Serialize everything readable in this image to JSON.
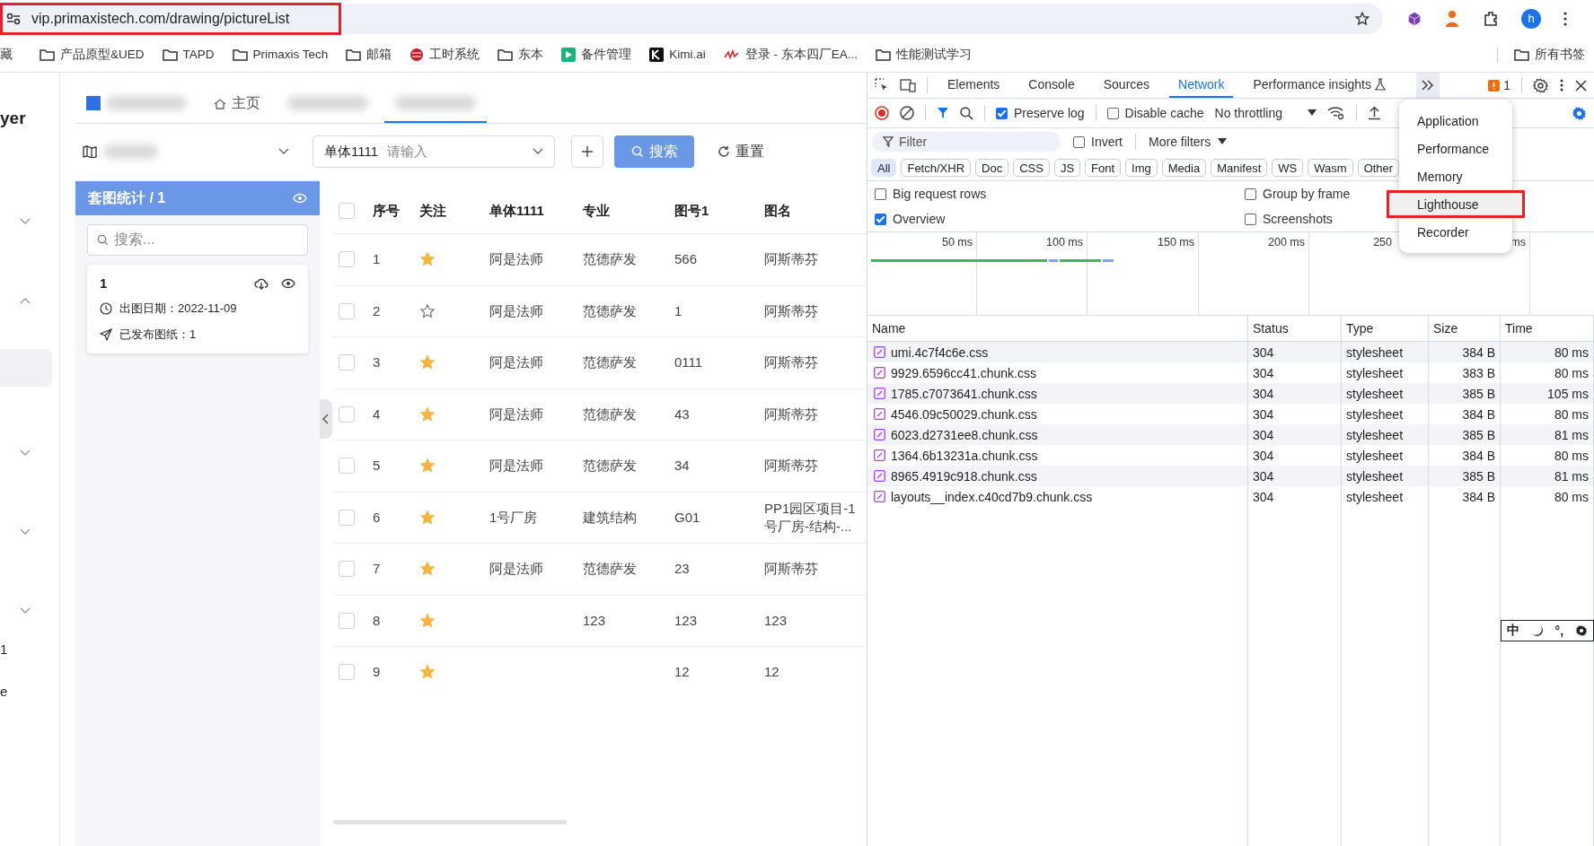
{
  "browser": {
    "address": "vip.primaxistech.com/drawing/pictureList",
    "address_annotated": true,
    "profile_initial": "h"
  },
  "bookmarks": [
    {
      "label": "藏",
      "kind": "none"
    },
    {
      "label": "产品原型&UED",
      "kind": "folder"
    },
    {
      "label": "TAPD",
      "kind": "folder"
    },
    {
      "label": "Primaxis Tech",
      "kind": "folder"
    },
    {
      "label": "邮箱",
      "kind": "folder"
    },
    {
      "label": "工时系统",
      "kind": "globe"
    },
    {
      "label": "东本",
      "kind": "folder"
    },
    {
      "label": "备件管理",
      "kind": "play"
    },
    {
      "label": "Kimi.ai",
      "kind": "letter"
    },
    {
      "label": "登录 - 东本四厂EA...",
      "kind": "mark"
    },
    {
      "label": "性能测试学习",
      "kind": "folder"
    }
  ],
  "bookmarks_all": "所有书签",
  "app": {
    "side_nav": [
      {
        "kind": "text",
        "label": "yer"
      },
      {
        "kind": "chevron",
        "expanded": false
      },
      {
        "kind": "chevron",
        "expanded": true
      },
      {
        "kind": "blank",
        "selected": true
      },
      {
        "kind": "chevron",
        "expanded": false
      },
      {
        "kind": "chevron",
        "expanded": false
      },
      {
        "kind": "chevron",
        "expanded": false
      },
      {
        "kind": "text",
        "label": "1"
      },
      {
        "kind": "text",
        "label": "e"
      }
    ],
    "tabs": [
      {
        "kind": "blurred",
        "selected": false
      },
      {
        "kind": "home",
        "label": "主页",
        "selected": false
      },
      {
        "kind": "blurred",
        "selected": false
      },
      {
        "kind": "blurred",
        "selected": true
      }
    ],
    "filter": {
      "field_label": "单体1111",
      "placeholder": "请输入",
      "search_button": "搜索",
      "reset_button": "重置"
    },
    "panel": {
      "title": "套图统计 / 1",
      "search_placeholder": "搜索...",
      "card": {
        "title": "1",
        "date": "出图日期：2022-11-09",
        "published": "已发布图纸：1"
      }
    },
    "table": {
      "checked": false,
      "columns": [
        "序号",
        "关注",
        "单体1111",
        "专业",
        "图号1",
        "图名"
      ],
      "rows": [
        {
          "no": "1",
          "starred": true,
          "unit": "阿是法师",
          "discipline": "范德萨发",
          "drawing_no": "566",
          "drawing_name": "阿斯蒂芬",
          "checked": false
        },
        {
          "no": "2",
          "starred": false,
          "unit": "阿是法师",
          "discipline": "范德萨发",
          "drawing_no": "1",
          "drawing_name": "阿斯蒂芬",
          "checked": false
        },
        {
          "no": "3",
          "starred": true,
          "unit": "阿是法师",
          "discipline": "范德萨发",
          "drawing_no": "0111",
          "drawing_name": "阿斯蒂芬",
          "checked": false
        },
        {
          "no": "4",
          "starred": true,
          "unit": "阿是法师",
          "discipline": "范德萨发",
          "drawing_no": "43",
          "drawing_name": "阿斯蒂芬",
          "checked": false
        },
        {
          "no": "5",
          "starred": true,
          "unit": "阿是法师",
          "discipline": "范德萨发",
          "drawing_no": "34",
          "drawing_name": "阿斯蒂芬",
          "checked": false
        },
        {
          "no": "6",
          "starred": true,
          "unit": "1号厂房",
          "discipline": "建筑结构",
          "drawing_no": "G01",
          "drawing_name": "PP1园区项目-1号厂房-结构-...",
          "checked": false
        },
        {
          "no": "7",
          "starred": true,
          "unit": "阿是法师",
          "discipline": "范德萨发",
          "drawing_no": "23",
          "drawing_name": "阿斯蒂芬",
          "checked": false
        },
        {
          "no": "8",
          "starred": true,
          "discipline": "123",
          "drawing_no": "123",
          "drawing_name": "123",
          "checked": false
        },
        {
          "no": "9",
          "starred": true,
          "drawing_no": "12",
          "drawing_name": "12",
          "checked": false
        }
      ]
    }
  },
  "devtools": {
    "tabs": [
      {
        "label": "Elements",
        "selected": false
      },
      {
        "label": "Console",
        "selected": false
      },
      {
        "label": "Sources",
        "selected": false
      },
      {
        "label": "Network",
        "selected": true
      },
      {
        "label": "Performance insights",
        "selected": false
      }
    ],
    "issues": "1",
    "preserve_log": {
      "label": "Preserve log",
      "checked": true
    },
    "disable_cache": {
      "label": "Disable cache",
      "checked": false
    },
    "throttling": "No throttling",
    "filter_placeholder": "Filter",
    "invert": {
      "label": "Invert",
      "checked": false
    },
    "more_filters": "More filters",
    "types": [
      {
        "label": "All",
        "selected": true
      },
      {
        "label": "Fetch/XHR",
        "selected": false
      },
      {
        "label": "Doc",
        "selected": false
      },
      {
        "label": "CSS",
        "selected": false
      },
      {
        "label": "JS",
        "selected": false
      },
      {
        "label": "Font",
        "selected": false
      },
      {
        "label": "Img",
        "selected": false
      },
      {
        "label": "Media",
        "selected": false
      },
      {
        "label": "Manifest",
        "selected": false
      },
      {
        "label": "WS",
        "selected": false
      },
      {
        "label": "Wasm",
        "selected": false
      },
      {
        "label": "Other",
        "selected": false
      }
    ],
    "options": [
      {
        "label": "Big request rows",
        "checked": false
      },
      {
        "label": "Group by frame",
        "checked": false
      },
      {
        "label": "Overview",
        "checked": true
      },
      {
        "label": "Screenshots",
        "checked": false
      }
    ],
    "ticks": [
      "50 ms",
      "100 ms",
      "150 ms",
      "200 ms",
      "250",
      "ms"
    ],
    "columns": [
      "Name",
      "Status",
      "Type",
      "Size",
      "Time"
    ],
    "requests": [
      {
        "name": "umi.4c7f4c6e.css",
        "status": "304",
        "type": "stylesheet",
        "size": "384 B",
        "time": "80 ms"
      },
      {
        "name": "9929.6596cc41.chunk.css",
        "status": "304",
        "type": "stylesheet",
        "size": "383 B",
        "time": "80 ms"
      },
      {
        "name": "1785.c7073641.chunk.css",
        "status": "304",
        "type": "stylesheet",
        "size": "385 B",
        "time": "105 ms"
      },
      {
        "name": "4546.09c50029.chunk.css",
        "status": "304",
        "type": "stylesheet",
        "size": "384 B",
        "time": "80 ms"
      },
      {
        "name": "6023.d2731ee8.chunk.css",
        "status": "304",
        "type": "stylesheet",
        "size": "385 B",
        "time": "81 ms"
      },
      {
        "name": "1364.6b13231a.chunk.css",
        "status": "304",
        "type": "stylesheet",
        "size": "384 B",
        "time": "80 ms"
      },
      {
        "name": "8965.4919c918.chunk.css",
        "status": "304",
        "type": "stylesheet",
        "size": "385 B",
        "time": "81 ms"
      },
      {
        "name": "layouts__index.c40cd7b9.chunk.css",
        "status": "304",
        "type": "stylesheet",
        "size": "384 B",
        "time": "80 ms"
      }
    ],
    "more_menu": [
      {
        "label": "Application",
        "annotated": false
      },
      {
        "label": "Performance",
        "annotated": false
      },
      {
        "label": "Memory",
        "annotated": false
      },
      {
        "label": "Lighthouse",
        "annotated": true
      },
      {
        "label": "Recorder",
        "annotated": false
      }
    ]
  },
  "ime_bar": {
    "mode": "中",
    "punctuation": "°,"
  }
}
